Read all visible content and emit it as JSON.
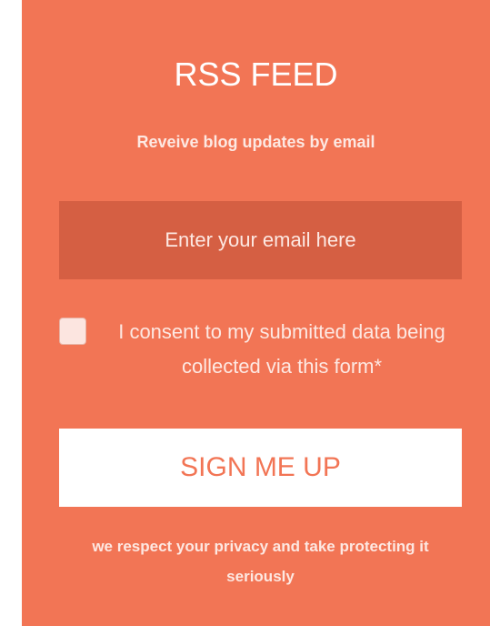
{
  "widget": {
    "title": "RSS FEED",
    "subtitle": "Reveive blog updates by email",
    "email_placeholder": "Enter your email here",
    "consent_text": "I consent to my submitted data being collected via this form*",
    "consent_checked": false,
    "button_label": "SIGN ME UP",
    "privacy_text": "we respect your privacy and take protecting it seriously"
  },
  "colors": {
    "panel_background": "#f27555",
    "input_background": "#d55f43",
    "button_background": "#ffffff",
    "button_text": "#f27555",
    "text": "#ffffff"
  }
}
